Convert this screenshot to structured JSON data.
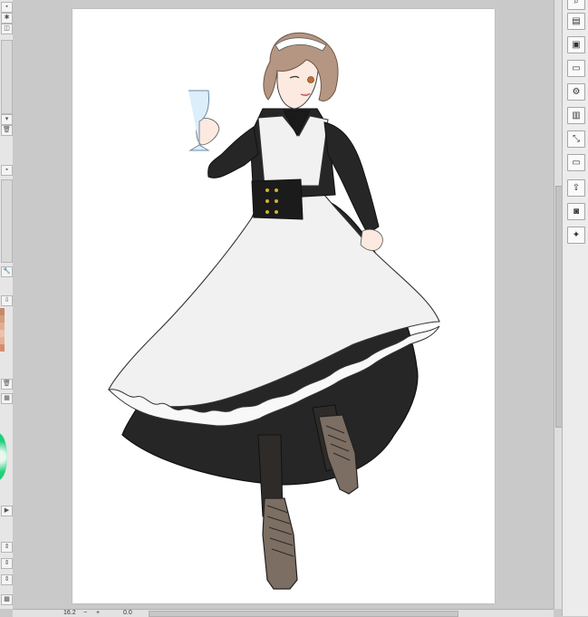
{
  "left_panel": {
    "buttons": [
      {
        "icon": "panel-toggle-icon",
        "glyph": "▪"
      },
      {
        "icon": "settings-icon",
        "glyph": "✱"
      },
      {
        "icon": "layer-icon",
        "glyph": "◫"
      },
      {
        "icon": "chevron-down-icon",
        "glyph": "▾"
      },
      {
        "icon": "trash-icon",
        "glyph": "🗑"
      },
      {
        "icon": "lock-icon",
        "glyph": "▪"
      },
      {
        "icon": "wrench-icon",
        "glyph": "🔧"
      },
      {
        "icon": "download-icon",
        "glyph": "⇩"
      },
      {
        "icon": "trash-icon",
        "glyph": "🗑"
      },
      {
        "icon": "grid-icon",
        "glyph": "▦"
      },
      {
        "icon": "play-icon",
        "glyph": "▶"
      },
      {
        "icon": "chevron-up-down-icon",
        "glyph": "⇕"
      },
      {
        "icon": "chevron-up-down-icon",
        "glyph": "⇕"
      },
      {
        "icon": "chevron-up-down-icon",
        "glyph": "⇕"
      },
      {
        "icon": "checker-icon",
        "glyph": "▩"
      }
    ],
    "colors": [
      "#c5896a",
      "#d69c7d",
      "#e2ae93",
      "#ecc3ab",
      "#e7b197",
      "#d58e6d"
    ],
    "accent_color": "#1fd07a"
  },
  "right_panel": {
    "buttons": [
      {
        "icon": "search-icon",
        "glyph": "⌕"
      },
      {
        "icon": "table-icon",
        "glyph": "▤"
      },
      {
        "icon": "image-icon",
        "glyph": "▣"
      },
      {
        "icon": "folder-icon",
        "glyph": "▭"
      },
      {
        "icon": "gear-icon",
        "glyph": "⚙"
      },
      {
        "icon": "layers-icon",
        "glyph": "▥"
      },
      {
        "icon": "transform-icon",
        "glyph": "⤡"
      },
      {
        "icon": "folder-icon",
        "glyph": "▭"
      },
      {
        "icon": "export-icon",
        "glyph": "⇪"
      },
      {
        "icon": "camera-icon",
        "glyph": "◙"
      },
      {
        "icon": "figure-icon",
        "glyph": "✦"
      }
    ]
  },
  "status": {
    "zoom": "16.2",
    "rotation": "0.0",
    "minus": "−",
    "plus": "+"
  },
  "illustration": {
    "skin_color": "#fce9df",
    "hair_color": "#b49683",
    "dress_color": "#262626",
    "apron_color": "#f1f1f1",
    "boot_color": "#7c6e62",
    "eye_color": "#c56e27",
    "glass_color": "#dceefa"
  }
}
